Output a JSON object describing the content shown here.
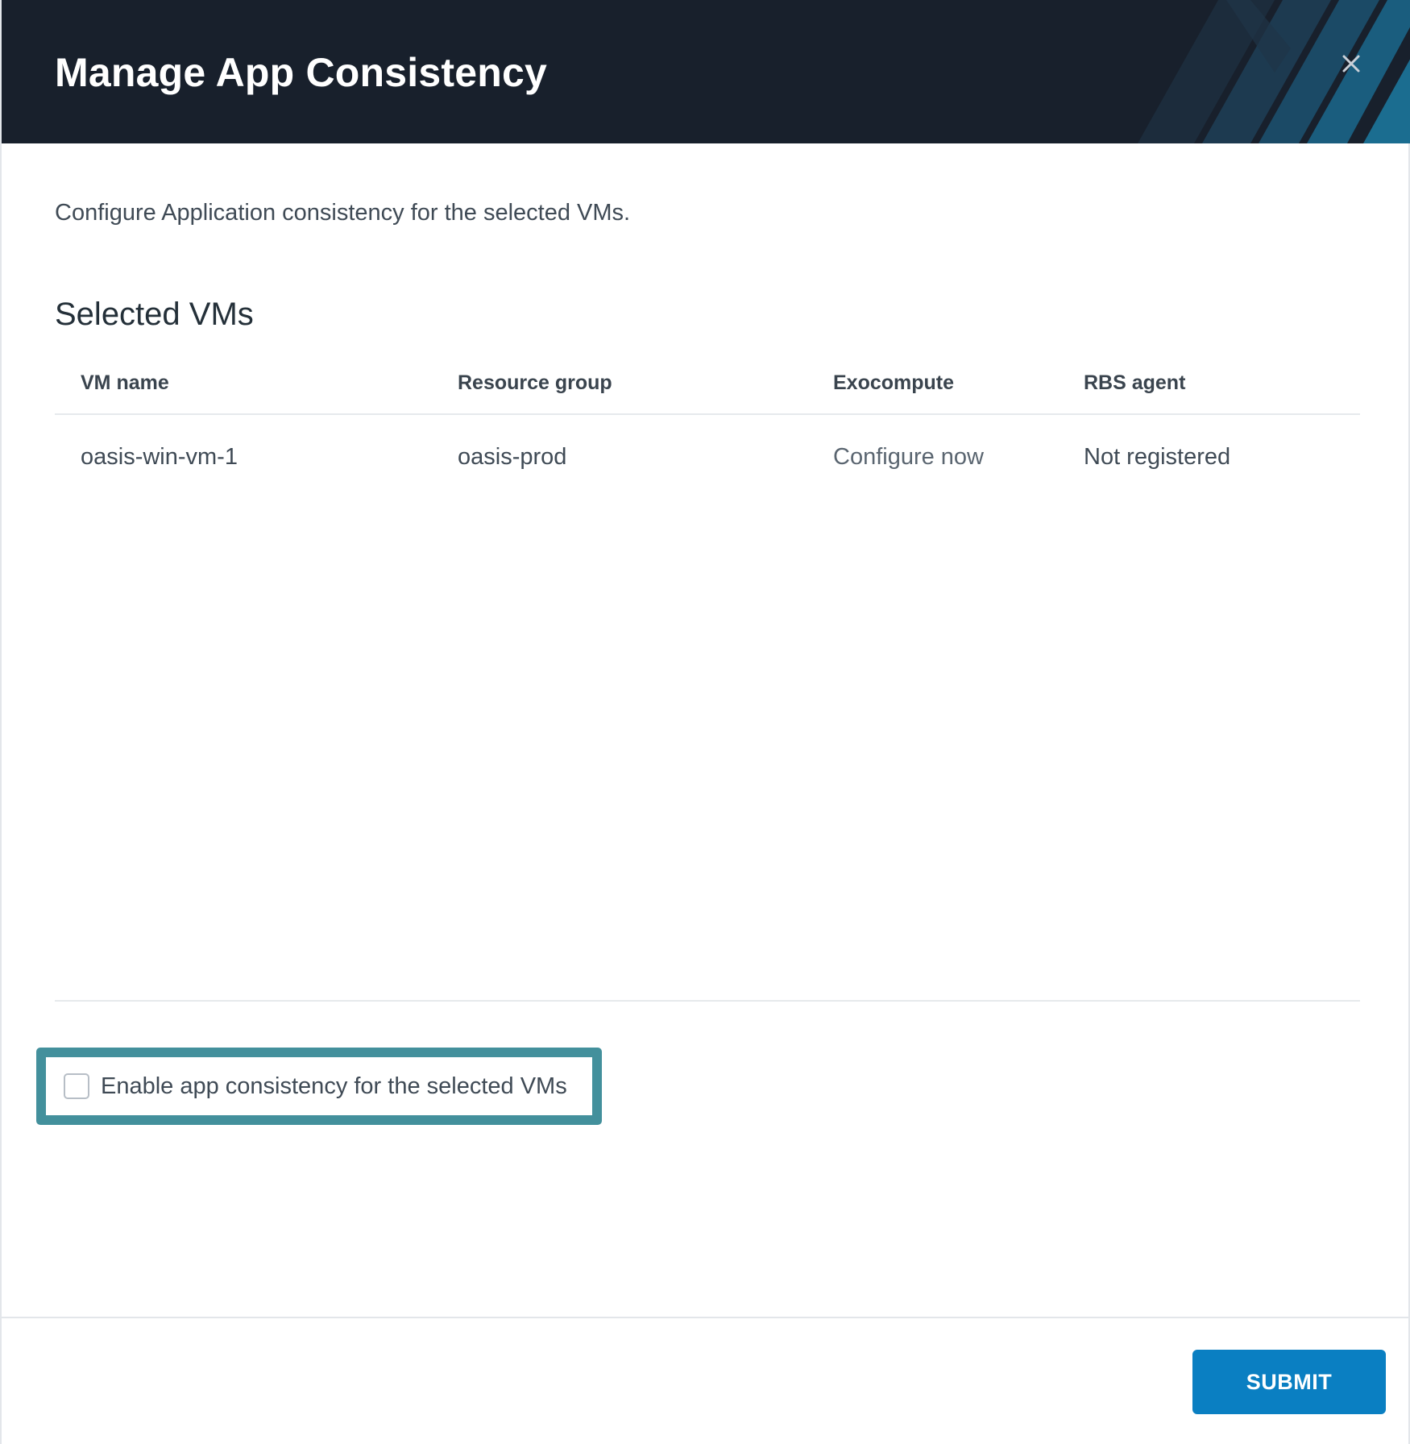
{
  "modal": {
    "title": "Manage App Consistency",
    "close_icon": "close-icon",
    "description": "Configure Application consistency for the selected VMs."
  },
  "selected_vms": {
    "section_title": "Selected VMs",
    "columns": [
      "VM name",
      "Resource group",
      "Exocompute",
      "RBS agent"
    ],
    "rows": [
      {
        "vm_name": "oasis-win-vm-1",
        "resource_group": "oasis-prod",
        "exocompute": "Configure now",
        "rbs_agent": "Not registered"
      }
    ]
  },
  "app_consistency": {
    "checkbox_label": "Enable app consistency for the selected VMs",
    "checked": false
  },
  "footer": {
    "submit_label": "SUBMIT"
  },
  "colors": {
    "header_bg": "#18202c",
    "highlight_frame": "#43909c",
    "primary_button": "#0a7fc2",
    "text": "#3f4a55"
  }
}
